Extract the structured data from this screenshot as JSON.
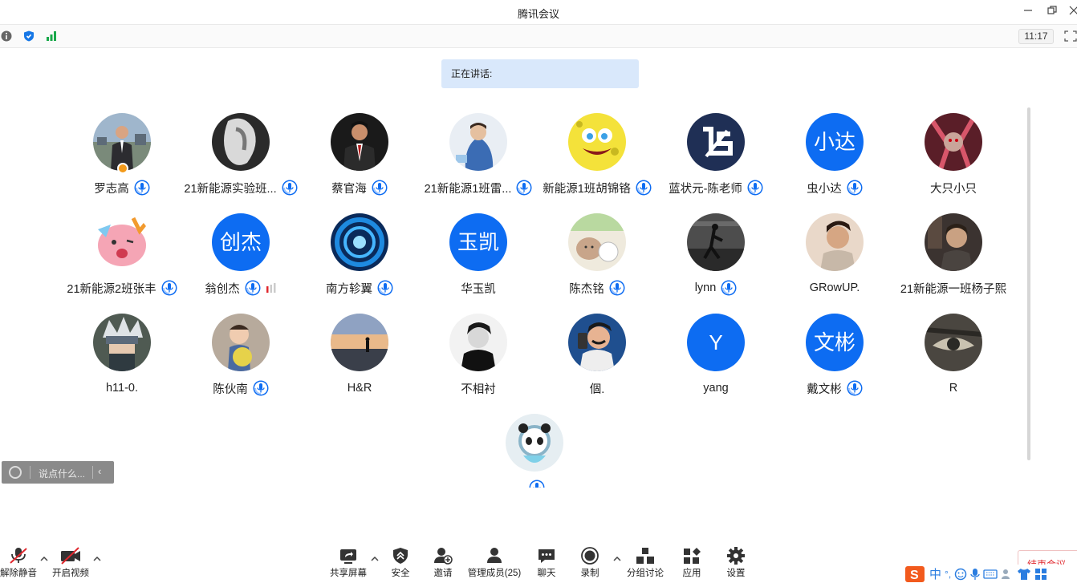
{
  "window": {
    "title": "腾讯会议"
  },
  "toolbar": {
    "time": "11:17"
  },
  "speaking": {
    "label": "正在讲话:"
  },
  "participants": [
    {
      "name": "罗志高",
      "avatar": "photo-man-suit",
      "mic": true,
      "host_badge": true,
      "volume": false
    },
    {
      "name": "21新能源实验班...",
      "avatar": "photo-blurred-figure",
      "mic": true,
      "host_badge": false,
      "volume": false
    },
    {
      "name": "蔡官海",
      "avatar": "photo-man-red-tie",
      "mic": true,
      "host_badge": false,
      "volume": false
    },
    {
      "name": "21新能源1班雷...",
      "avatar": "photo-child-blue",
      "mic": true,
      "host_badge": false,
      "volume": false
    },
    {
      "name": "新能源1班胡锦铬",
      "avatar": "spongebob",
      "mic": true,
      "host_badge": false,
      "volume": false
    },
    {
      "name": "蓝状元-陈老师",
      "avatar": "logo-navy",
      "mic": true,
      "host_badge": false,
      "volume": false
    },
    {
      "name": "虫小达",
      "avatar_text": "小达",
      "mic": true,
      "host_badge": false,
      "volume": false
    },
    {
      "name": "大只小只",
      "avatar": "anime-red",
      "mic": false,
      "host_badge": false,
      "volume": false
    },
    {
      "name": "21新能源2班张丰",
      "avatar": "cartoon-pig",
      "mic": true,
      "host_badge": false,
      "volume": false
    },
    {
      "name": "翁创杰",
      "avatar_text": "创杰",
      "mic": true,
      "host_badge": false,
      "volume": true
    },
    {
      "name": "南方轸翼",
      "avatar": "blue-swirl",
      "mic": true,
      "host_badge": false,
      "volume": false
    },
    {
      "name": "华玉凯",
      "avatar_text": "玉凯",
      "mic": false,
      "host_badge": false,
      "volume": false
    },
    {
      "name": "陈杰铭",
      "avatar": "cartoon-animals",
      "mic": true,
      "host_badge": false,
      "volume": false
    },
    {
      "name": "lynn",
      "avatar": "photo-runner",
      "mic": true,
      "host_badge": false,
      "volume": false
    },
    {
      "name": "GRowUP.",
      "avatar": "photo-young-man",
      "mic": false,
      "host_badge": false,
      "volume": false
    },
    {
      "name": "21新能源一班杨子熙",
      "avatar": "photo-man-studio",
      "mic": false,
      "host_badge": false,
      "volume": false
    },
    {
      "name": "h11-0.",
      "avatar": "anime-kakashi",
      "mic": false,
      "host_badge": false,
      "volume": false
    },
    {
      "name": "陈伙南",
      "avatar": "photo-baby",
      "mic": true,
      "host_badge": false,
      "volume": false
    },
    {
      "name": "H&R",
      "avatar": "photo-sunset",
      "mic": false,
      "host_badge": false,
      "volume": false
    },
    {
      "name": "不相衬",
      "avatar": "photo-bw-man",
      "mic": false,
      "host_badge": false,
      "volume": false
    },
    {
      "name": "個.",
      "avatar": "cartoon-selfie",
      "mic": false,
      "host_badge": false,
      "volume": false
    },
    {
      "name": "yang",
      "avatar_text": "Y",
      "mic": false,
      "host_badge": false,
      "volume": false
    },
    {
      "name": "戴文彬",
      "avatar_text": "文彬",
      "mic": true,
      "host_badge": false,
      "volume": false
    },
    {
      "name": "R",
      "avatar": "anime-eye",
      "mic": false,
      "host_badge": false,
      "volume": false
    },
    {
      "name": "",
      "avatar": "cartoon-panda",
      "mic": true,
      "host_badge": false,
      "volume": false
    }
  ],
  "chat": {
    "placeholder": "说点什么..."
  },
  "bottom": {
    "unmute": "解除静音",
    "video": "开启视频",
    "share": "共享屏幕",
    "security": "安全",
    "invite": "邀请",
    "members": "管理成员(25)",
    "chat": "聊天",
    "record": "录制",
    "breakout": "分组讨论",
    "apps": "应用",
    "settings": "设置",
    "end": "结束会议"
  },
  "ime": {
    "lang": "中"
  },
  "colors": {
    "accent": "#0d6cf2",
    "speaking_bg": "#d9e8fb",
    "end": "#e0282e",
    "signal": "#19a84a"
  }
}
